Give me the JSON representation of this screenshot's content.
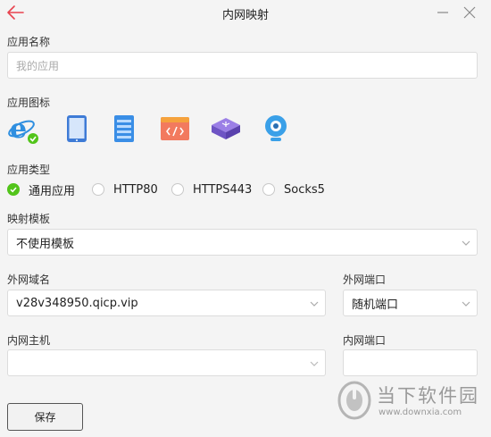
{
  "window": {
    "title": "内网映射",
    "back_icon": "back-arrow-icon",
    "minimize_icon": "minimize-icon",
    "close_icon": "close-icon"
  },
  "app_name": {
    "label": "应用名称",
    "placeholder": "我的应用",
    "value": ""
  },
  "app_icon": {
    "label": "应用图标",
    "icons": [
      "ie-browser-icon",
      "tablet-icon",
      "server-icon",
      "code-window-icon",
      "router-icon",
      "webcam-icon"
    ],
    "selected": "ie-browser-icon"
  },
  "app_type": {
    "label": "应用类型",
    "options": [
      "通用应用",
      "HTTP80",
      "HTTPS443",
      "Socks5"
    ],
    "selected": "通用应用"
  },
  "mapping_template": {
    "label": "映射模板",
    "value": "不使用模板"
  },
  "external_domain": {
    "label": "外网域名",
    "value": "v28v348950.qicp.vip"
  },
  "external_port": {
    "label": "外网端口",
    "value": "随机端口"
  },
  "internal_host": {
    "label": "内网主机",
    "value": ""
  },
  "internal_port": {
    "label": "内网端口",
    "value": ""
  },
  "save_button": {
    "label": "保存"
  },
  "watermark": {
    "text": "当下软件园",
    "url": "www.downxia.com"
  },
  "colors": {
    "accent_red": "#e8434f",
    "check_green": "#52c41a",
    "border": "#dcdcdc"
  }
}
